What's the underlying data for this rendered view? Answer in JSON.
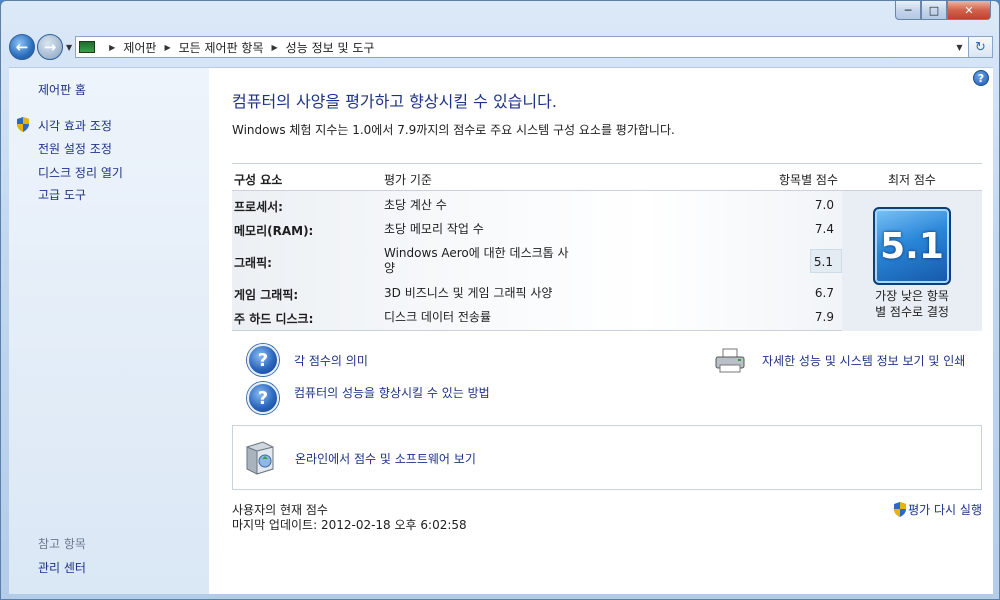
{
  "window": {
    "minimize_glyph": "─",
    "maximize_glyph": "□",
    "close_glyph": "✕"
  },
  "navbar": {
    "back_glyph": "←",
    "forward_glyph": "→",
    "breadcrumbs": [
      "제어판",
      "모든 제어판 항목",
      "성능 정보 및 도구"
    ],
    "refresh_glyph": "↻"
  },
  "sidebar": {
    "home": "제어판 홈",
    "items": [
      {
        "label": "시각 효과 조정",
        "icon": "uac-shield-icon"
      },
      {
        "label": "전원 설정 조정"
      },
      {
        "label": "디스크 정리 열기"
      },
      {
        "label": "고급 도구"
      }
    ],
    "see_also_title": "참고 항목",
    "see_also_items": [
      "관리 센터"
    ]
  },
  "main": {
    "heading": "컴퓨터의 사양을 평가하고 향상시킬 수 있습니다.",
    "subtext": "Windows 체험 지수는 1.0에서 7.9까지의 점수로 주요 시스템 구성 요소를 평가합니다.",
    "table": {
      "headers": {
        "component": "구성 요소",
        "rated": "평가 기준",
        "subscore": "항목별 점수",
        "base": "최저 점수"
      },
      "rows": [
        {
          "name": "프로세서:",
          "criteria": "초당 계산 수",
          "score": "7.0"
        },
        {
          "name": "메모리(RAM):",
          "criteria": "초당 메모리 작업 수",
          "score": "7.4"
        },
        {
          "name": "그래픽:",
          "criteria": "Windows Aero에 대한 데스크톱 사양",
          "score": "5.1"
        },
        {
          "name": "게임 그래픽:",
          "criteria": "3D 비즈니스 및 게임 그래픽 사양",
          "score": "6.7"
        },
        {
          "name": "주 하드 디스크:",
          "criteria": "디스크 데이터 전송률",
          "score": "7.9"
        }
      ],
      "base_score": "5.1",
      "base_desc_line1": "가장 낮은 항목",
      "base_desc_line2": "별 점수로 결정"
    },
    "links": {
      "meaning": "각 점수의 의미",
      "improve": "컴퓨터의 성능을 향상시킬 수 있는 방법",
      "print": "자세한 성능 및 시스템 정보 보기 및 인쇄",
      "online": "온라인에서 점수 및 소프트웨어 보기"
    },
    "footer": {
      "current_score": "사용자의 현재 점수",
      "last_update": "마지막 업데이트: 2012-02-18 오후 6:02:58",
      "rerun": "평가 다시 실행"
    }
  }
}
